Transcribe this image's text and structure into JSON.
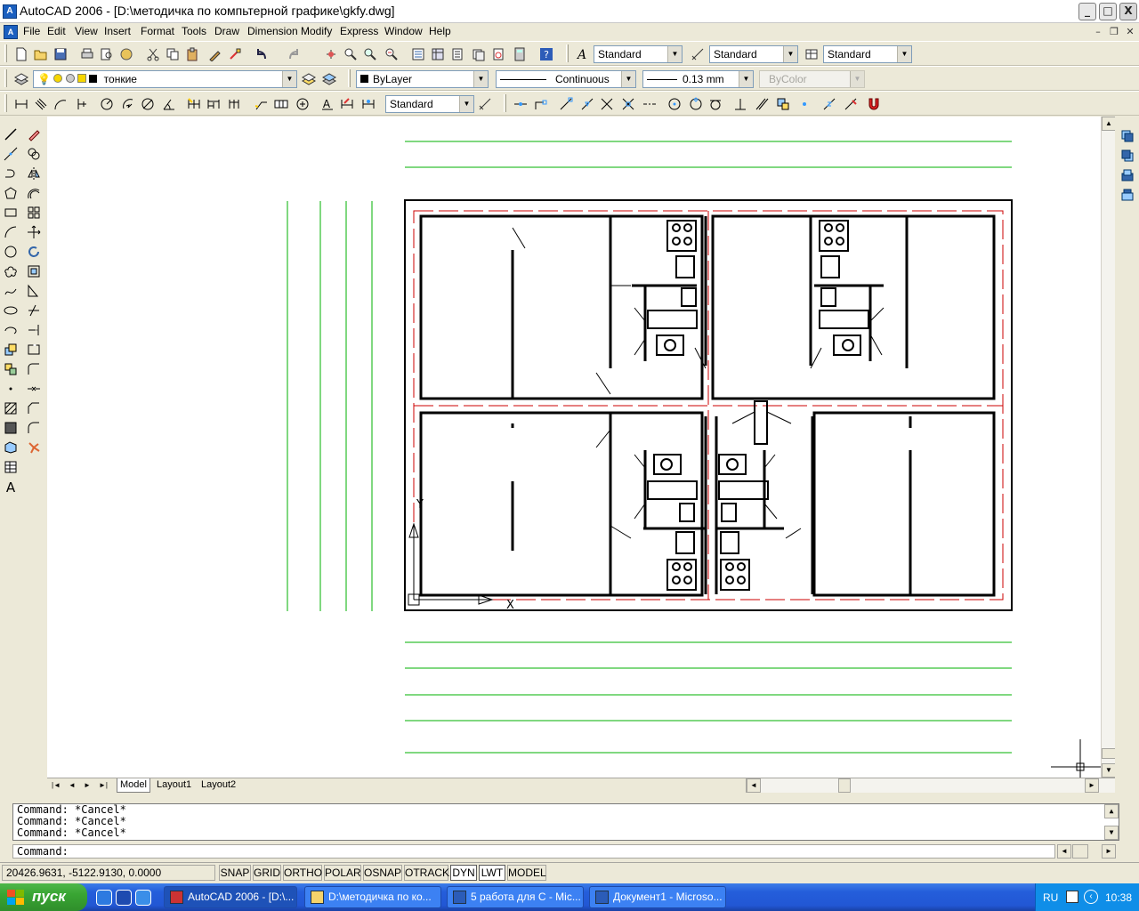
{
  "window": {
    "title": "AutoCAD 2006 - [D:\\методичка по компьтерной графике\\gkfy.dwg]",
    "app_icon_glyph": "A",
    "controls": [
      "_",
      "□",
      "X"
    ]
  },
  "menu": {
    "items": [
      "File",
      "Edit",
      "View",
      "Insert",
      "Format",
      "Tools",
      "Draw",
      "Dimension",
      "Modify",
      "Express",
      "Window",
      "Help"
    ]
  },
  "toolbar_standard": {
    "text_style": "Standard",
    "dim_style": "Standard",
    "table_style": "Standard"
  },
  "toolbar_layers": {
    "layer": "тонкие",
    "color": "ByLayer",
    "linetype": "Continuous",
    "lineweight": "0.13 mm",
    "plotstyle": "ByColor"
  },
  "toolbar_dim": {
    "dim_style": "Standard"
  },
  "drawing": {
    "layer_colors": {
      "outline": "#000000",
      "axis": "#cc0000",
      "frame": "#00b000"
    }
  },
  "tabs": {
    "nav": [
      "|◄",
      "◄",
      "►",
      "►|"
    ],
    "items": [
      "Model",
      "Layout1",
      "Layout2"
    ],
    "active": "Model"
  },
  "command": {
    "history": [
      "Command: *Cancel*",
      "Command: *Cancel*",
      "Command: *Cancel*"
    ],
    "prompt": "Command:"
  },
  "status": {
    "coords": "20426.9631, -5122.9130, 0.0000",
    "toggles": [
      {
        "label": "SNAP",
        "on": false
      },
      {
        "label": "GRID",
        "on": false
      },
      {
        "label": "ORTHO",
        "on": false
      },
      {
        "label": "POLAR",
        "on": false
      },
      {
        "label": "OSNAP",
        "on": false
      },
      {
        "label": "OTRACK",
        "on": false
      },
      {
        "label": "DYN",
        "on": true
      },
      {
        "label": "LWT",
        "on": true
      },
      {
        "label": "MODEL",
        "on": false
      }
    ]
  },
  "taskbar": {
    "start_label": "пуск",
    "buttons": [
      {
        "label": "AutoCAD 2006 - [D:\\...",
        "active": true
      },
      {
        "label": "D:\\методичка по ко...",
        "active": false
      },
      {
        "label": "5 работа для С - Mic...",
        "active": false
      },
      {
        "label": "Документ1 - Microso...",
        "active": false
      }
    ],
    "lang": "RU",
    "clock": "10:38"
  }
}
